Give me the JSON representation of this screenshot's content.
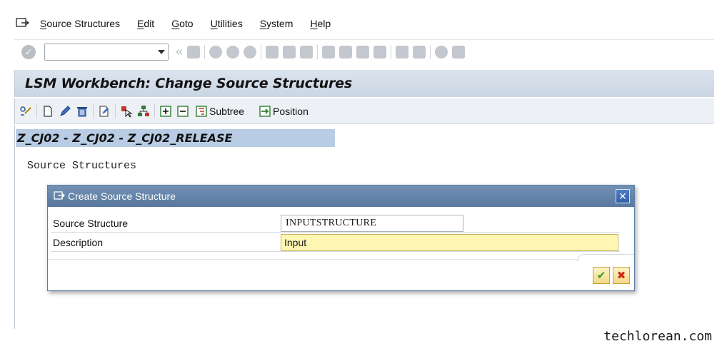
{
  "menu": {
    "items": [
      "Source Structures",
      "Edit",
      "Goto",
      "Utilities",
      "System",
      "Help"
    ]
  },
  "toolbar": {
    "command_field_value": "",
    "nav_back_glyph": "«"
  },
  "title": "LSM Workbench: Change Source Structures",
  "app_toolbar": {
    "subtree_label": "Subtree",
    "position_label": "Position"
  },
  "path_header": "Z_CJ02 - Z_CJ02 - Z_CJ02_RELEASE",
  "tree_root_label": "Source Structures",
  "dialog": {
    "title": "Create Source Structure",
    "close_glyph": "✕",
    "fields": [
      {
        "label": "Source Structure",
        "value": "INPUTSTRUCTURE"
      },
      {
        "label": "Description",
        "value": "Input"
      }
    ],
    "ok_glyph": "✔",
    "cancel_glyph": "✖"
  },
  "watermark": "techlorean.com",
  "colors": {
    "title_bar": "#cad6e3",
    "dialog_header": "#59789f",
    "path_header": "#b8cce4",
    "required_field": "#fff6b3"
  }
}
